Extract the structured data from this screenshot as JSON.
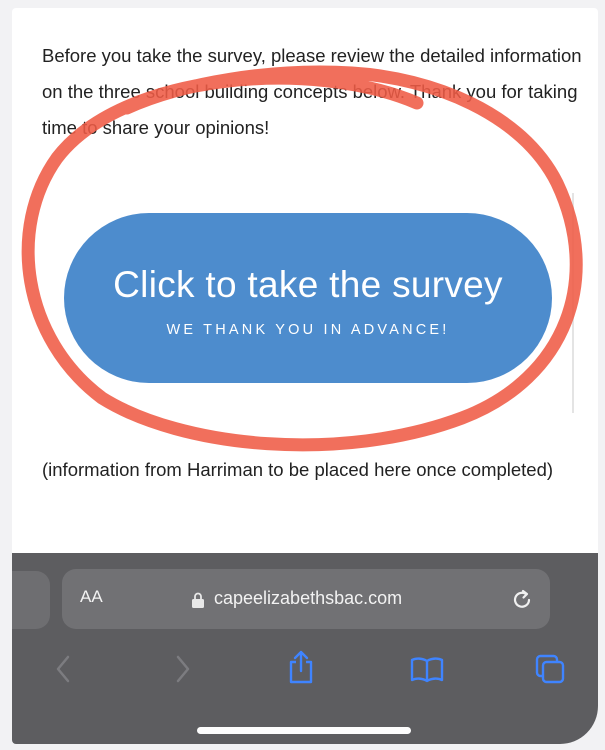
{
  "intro_text": "Before you take the survey, please review the detailed information on the three school building concepts below. Thank you for taking time to share your opinions!",
  "survey_button": {
    "title": "Click to take the survey",
    "subtitle": "WE THANK YOU IN ADVANCE!",
    "color": "#4d8ccd"
  },
  "info_note": "(information from Harriman to be placed here once completed)",
  "browser": {
    "text_size_label": "AA",
    "url": "capeelizabethsbac.com",
    "icons": [
      "lock-icon",
      "reload-icon",
      "back-icon",
      "forward-icon",
      "share-icon",
      "bookmarks-icon",
      "tabs-icon"
    ],
    "accent_color": "#3f84ff"
  },
  "annotation_color": "#ef5b46"
}
